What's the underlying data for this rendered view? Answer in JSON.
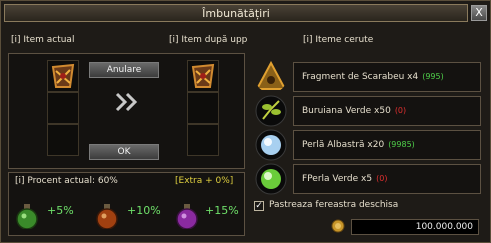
{
  "window": {
    "title": "Îmbunătățiri",
    "close_label": "X"
  },
  "headers": {
    "current": "[i] Item actual",
    "after": "[i] Item după upp",
    "required": "[i] Iteme cerute"
  },
  "buttons": {
    "cancel": "Anulare",
    "ok": "OK"
  },
  "upgrade": {
    "percent_label": "[i] Procent actual: 60%",
    "extra_label": "[Extra + 0%]",
    "potions": [
      {
        "bonus": "+5%",
        "color": "#3a8a2a"
      },
      {
        "bonus": "+10%",
        "color": "#a04010"
      },
      {
        "bonus": "+15%",
        "color": "#8a2aa0"
      }
    ]
  },
  "required_items": [
    {
      "name": "Fragment de Scarabeu x4",
      "count": "(995)",
      "count_color": "#4fd04a",
      "icon": "scarab-fragment-icon"
    },
    {
      "name": "Buruiana Verde x50",
      "count": "(0)",
      "count_color": "#e03030",
      "icon": "green-herb-icon"
    },
    {
      "name": "Perlă Albastră x20",
      "count": "(9985)",
      "count_color": "#4fd04a",
      "icon": "blue-pearl-icon"
    },
    {
      "name": "FPerla Verde x5",
      "count": "(0)",
      "count_color": "#e03030",
      "icon": "green-pearl-icon"
    }
  ],
  "keep_window": {
    "label": "Pastreaza fereastra deschisa",
    "checked": true
  },
  "gold": {
    "value": "100.000.000"
  }
}
